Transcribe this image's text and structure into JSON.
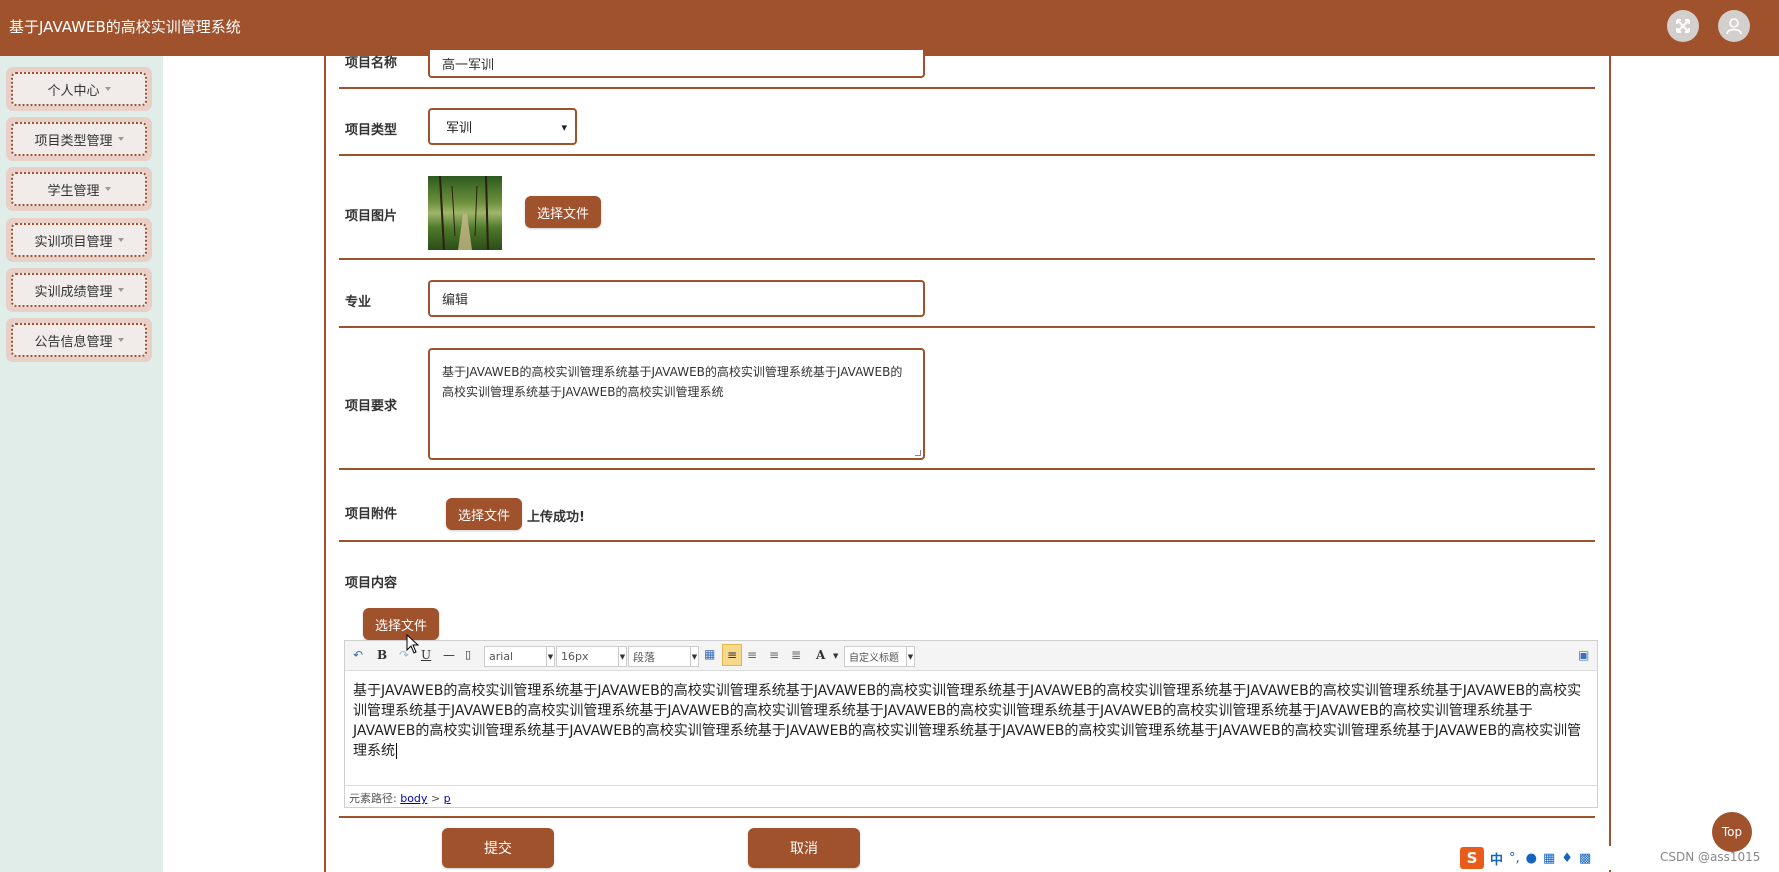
{
  "app": {
    "title": "基于JAVAWEB的高校实训管理系统"
  },
  "sidebar": {
    "items": [
      {
        "label": "个人中心"
      },
      {
        "label": "项目类型管理"
      },
      {
        "label": "学生管理"
      },
      {
        "label": "实训项目管理"
      },
      {
        "label": "实训成绩管理"
      },
      {
        "label": "公告信息管理"
      }
    ]
  },
  "form": {
    "name_label": "项目名称",
    "name_value": "高一军训",
    "type_label": "项目类型",
    "type_value": "军训",
    "image_label": "项目图片",
    "image_choose": "选择文件",
    "major_label": "专业",
    "major_value": "编辑",
    "req_label": "项目要求",
    "req_value": "基于JAVAWEB的高校实训管理系统基于JAVAWEB的高校实训管理系统基于JAVAWEB的高校实训管理系统基于JAVAWEB的高校实训管理系统",
    "attach_label": "项目附件",
    "attach_choose": "选择文件",
    "attach_status": "上传成功!",
    "content_label": "项目内容",
    "content_choose": "选择文件",
    "submit": "提交",
    "cancel": "取消"
  },
  "editor": {
    "toolbar": {
      "bold": "B",
      "underline": "U",
      "font": "arial",
      "size": "16px",
      "paragraph": "段落",
      "font_color": "A",
      "custom_title": "自定义标题"
    },
    "content": "基于JAVAWEB的高校实训管理系统基于JAVAWEB的高校实训管理系统基于JAVAWEB的高校实训管理系统基于JAVAWEB的高校实训管理系统基于JAVAWEB的高校实训管理系统基于JAVAWEB的高校实训管理系统基于JAVAWEB的高校实训管理系统基于JAVAWEB的高校实训管理系统基于JAVAWEB的高校实训管理系统基于JAVAWEB的高校实训管理系统基于JAVAWEB的高校实训管理系统基于JAVAWEB的高校实训管理系统基于JAVAWEB的高校实训管理系统基于JAVAWEB的高校实训管理系统基于JAVAWEB的高校实训管理系统基于JAVAWEB的高校实训管理系统基于JAVAWEB的高校实训管理系统",
    "path_prefix": "元素路径:",
    "path_body": "body",
    "path_sep": ">",
    "path_p": "p"
  },
  "floating": {
    "top_label": "Top",
    "ime_char": "中",
    "watermark": "CSDN @ass1015"
  },
  "colors": {
    "brand": "#a0522d",
    "sidebar_bg": "#e0ede8"
  }
}
